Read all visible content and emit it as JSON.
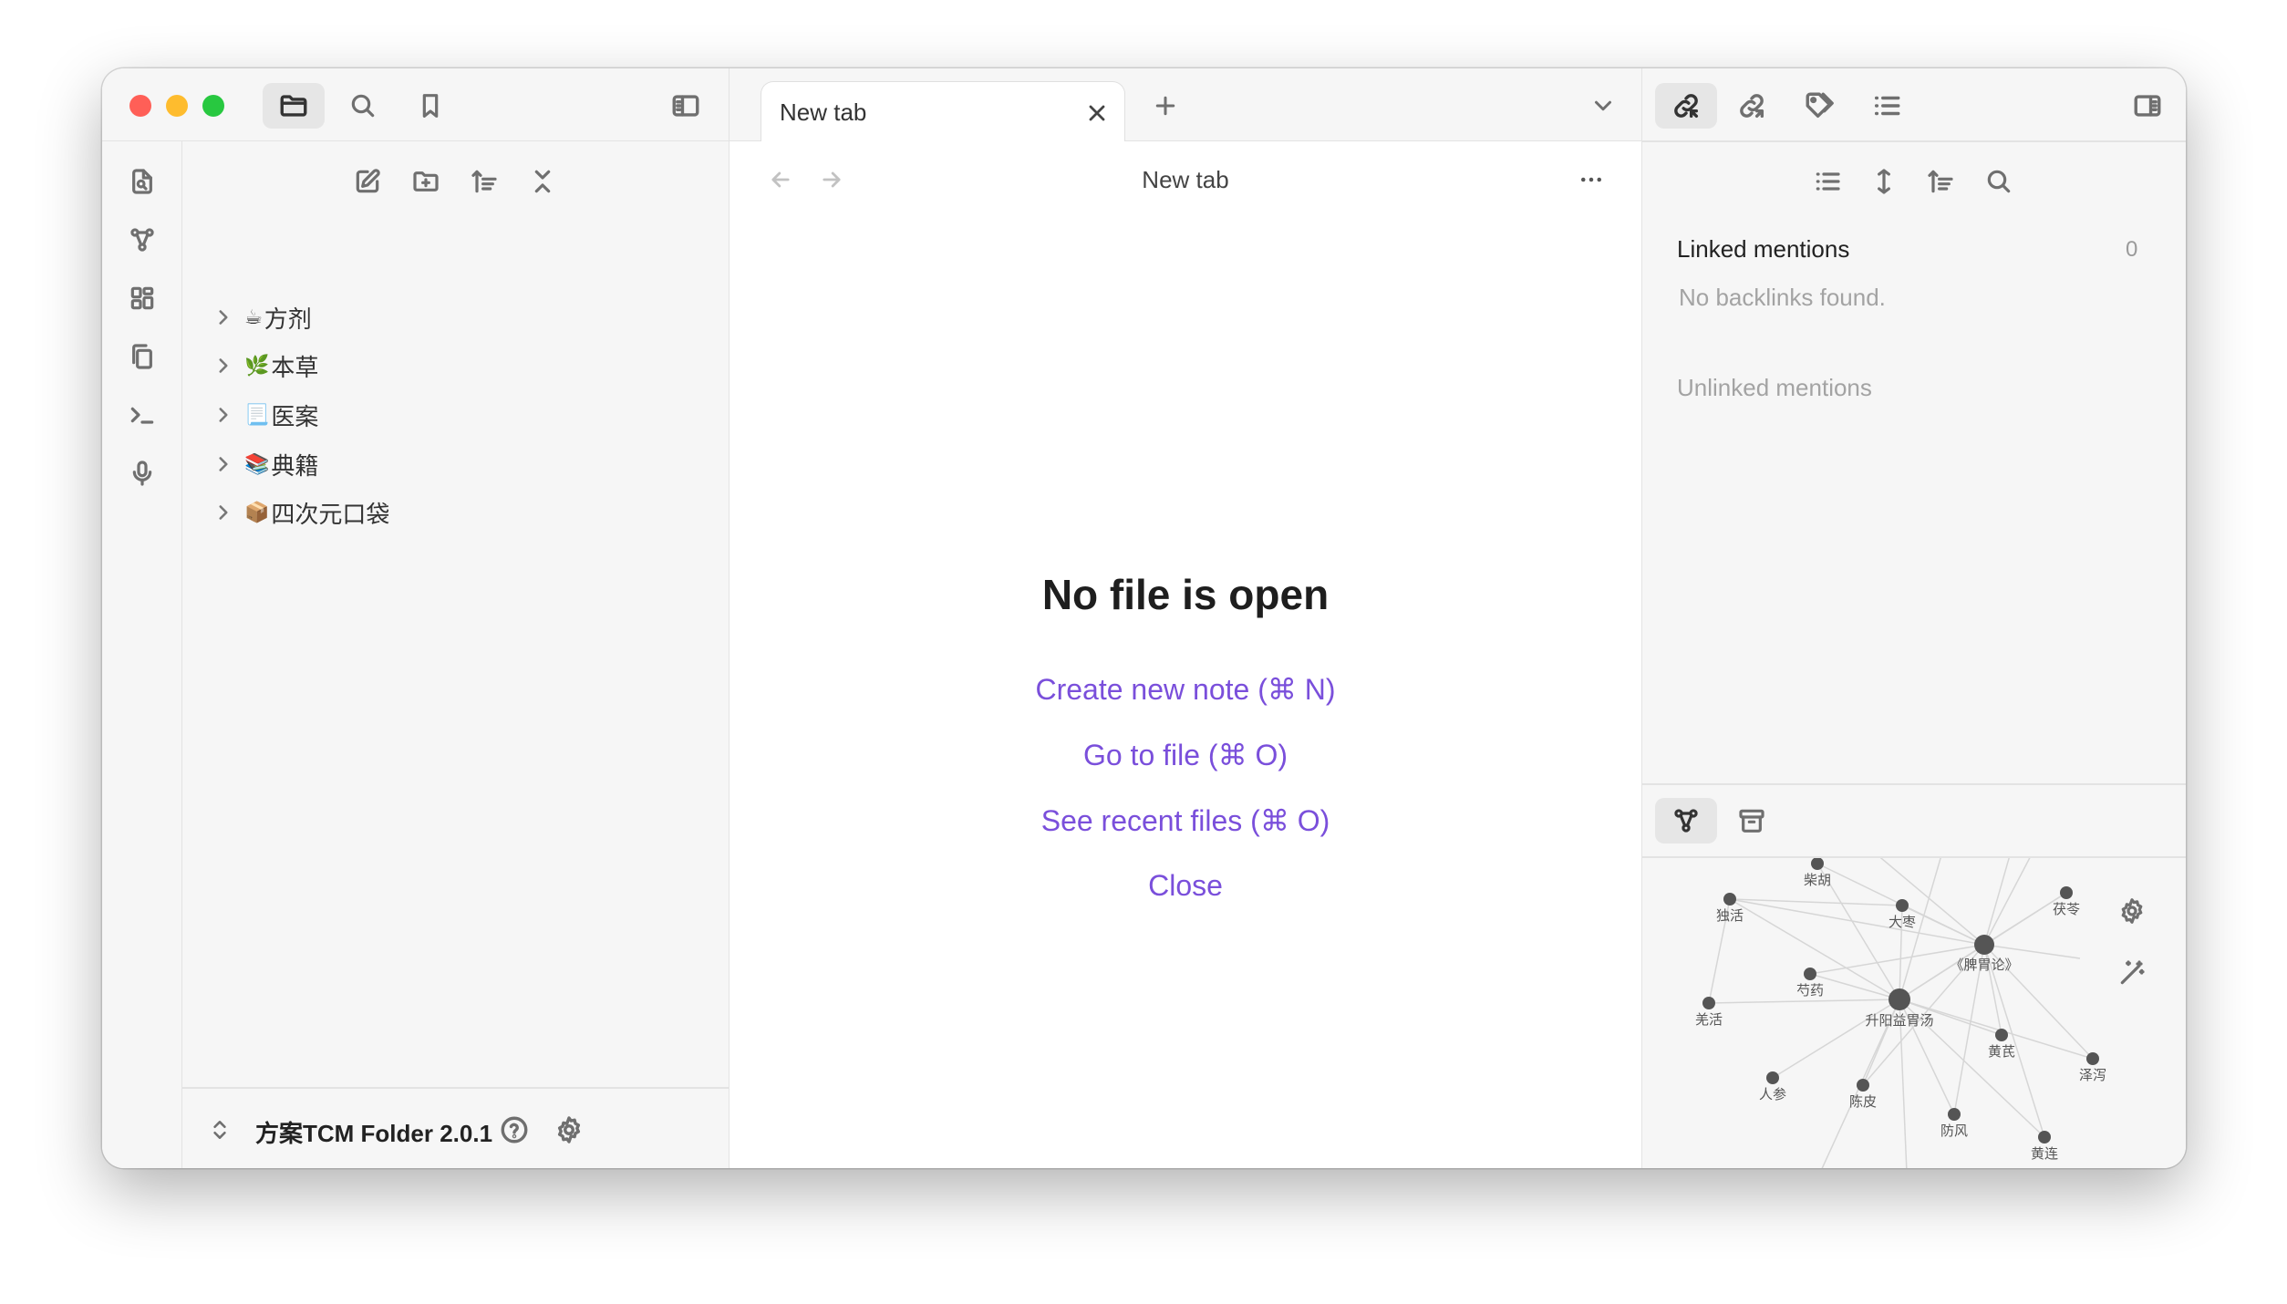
{
  "left_panel": {
    "tree": [
      {
        "icon": "☕",
        "label": "方剂"
      },
      {
        "icon": "🌿",
        "label": "本草"
      },
      {
        "icon": "📃",
        "label": "医案"
      },
      {
        "icon": "📚",
        "label": "典籍"
      },
      {
        "icon": "📦",
        "label": "四次元口袋"
      }
    ],
    "vault_name": "方案TCM Folder 2.0.1"
  },
  "tabs": [
    {
      "label": "New tab"
    }
  ],
  "editor": {
    "view_title": "New tab",
    "empty_title": "No file is open",
    "actions": [
      "Create new note (⌘ N)",
      "Go to file (⌘ O)",
      "See recent files (⌘ O)",
      "Close"
    ]
  },
  "right_panel": {
    "linked_mentions": "Linked mentions",
    "linked_count": "0",
    "no_backlinks": "No backlinks found.",
    "unlinked_mentions": "Unlinked mentions"
  },
  "graph": {
    "nodes": [
      "柴胡",
      "独活",
      "大枣",
      "茯苓",
      "《脾胃论》",
      "芍药",
      "羌活",
      "升阳益胃汤",
      "黄芪",
      "泽泻",
      "人参",
      "陈皮",
      "防风",
      "黄连"
    ]
  },
  "colors": {
    "accent": "#7a4fdb",
    "pane_bg": "#f6f6f6",
    "close": "#ff5f57",
    "minimize": "#febc2e",
    "zoom": "#28c840"
  }
}
